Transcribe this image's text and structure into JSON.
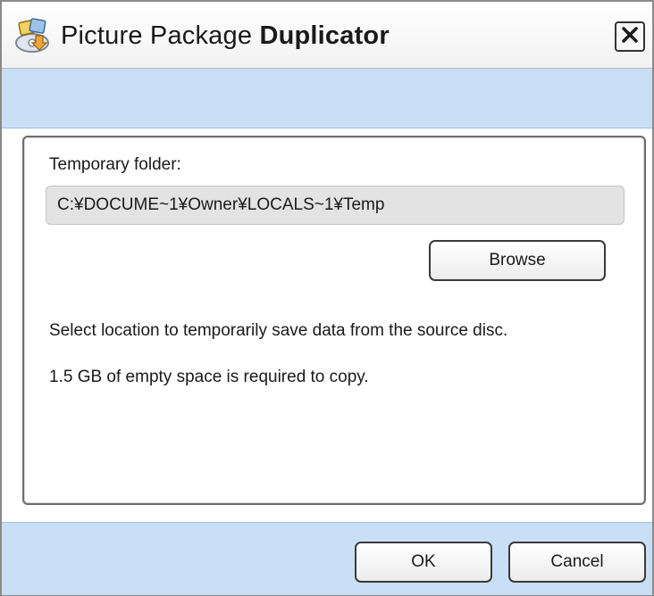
{
  "window": {
    "title_prefix": "Picture Package ",
    "title_bold": "Duplicator"
  },
  "panel": {
    "folder_label": "Temporary folder:",
    "folder_path": "C:¥DOCUME~1¥Owner¥LOCALS~1¥Temp",
    "browse_label": "Browse",
    "description": "Select location to temporarily save data from the source disc.",
    "space_note": "1.5 GB of empty space is required to copy."
  },
  "footer": {
    "ok_label": "OK",
    "cancel_label": "Cancel"
  },
  "icons": {
    "app": "picture-package-icon",
    "close": "close-icon"
  },
  "colors": {
    "band": "#c9dff5",
    "field": "#e3e3e3"
  }
}
